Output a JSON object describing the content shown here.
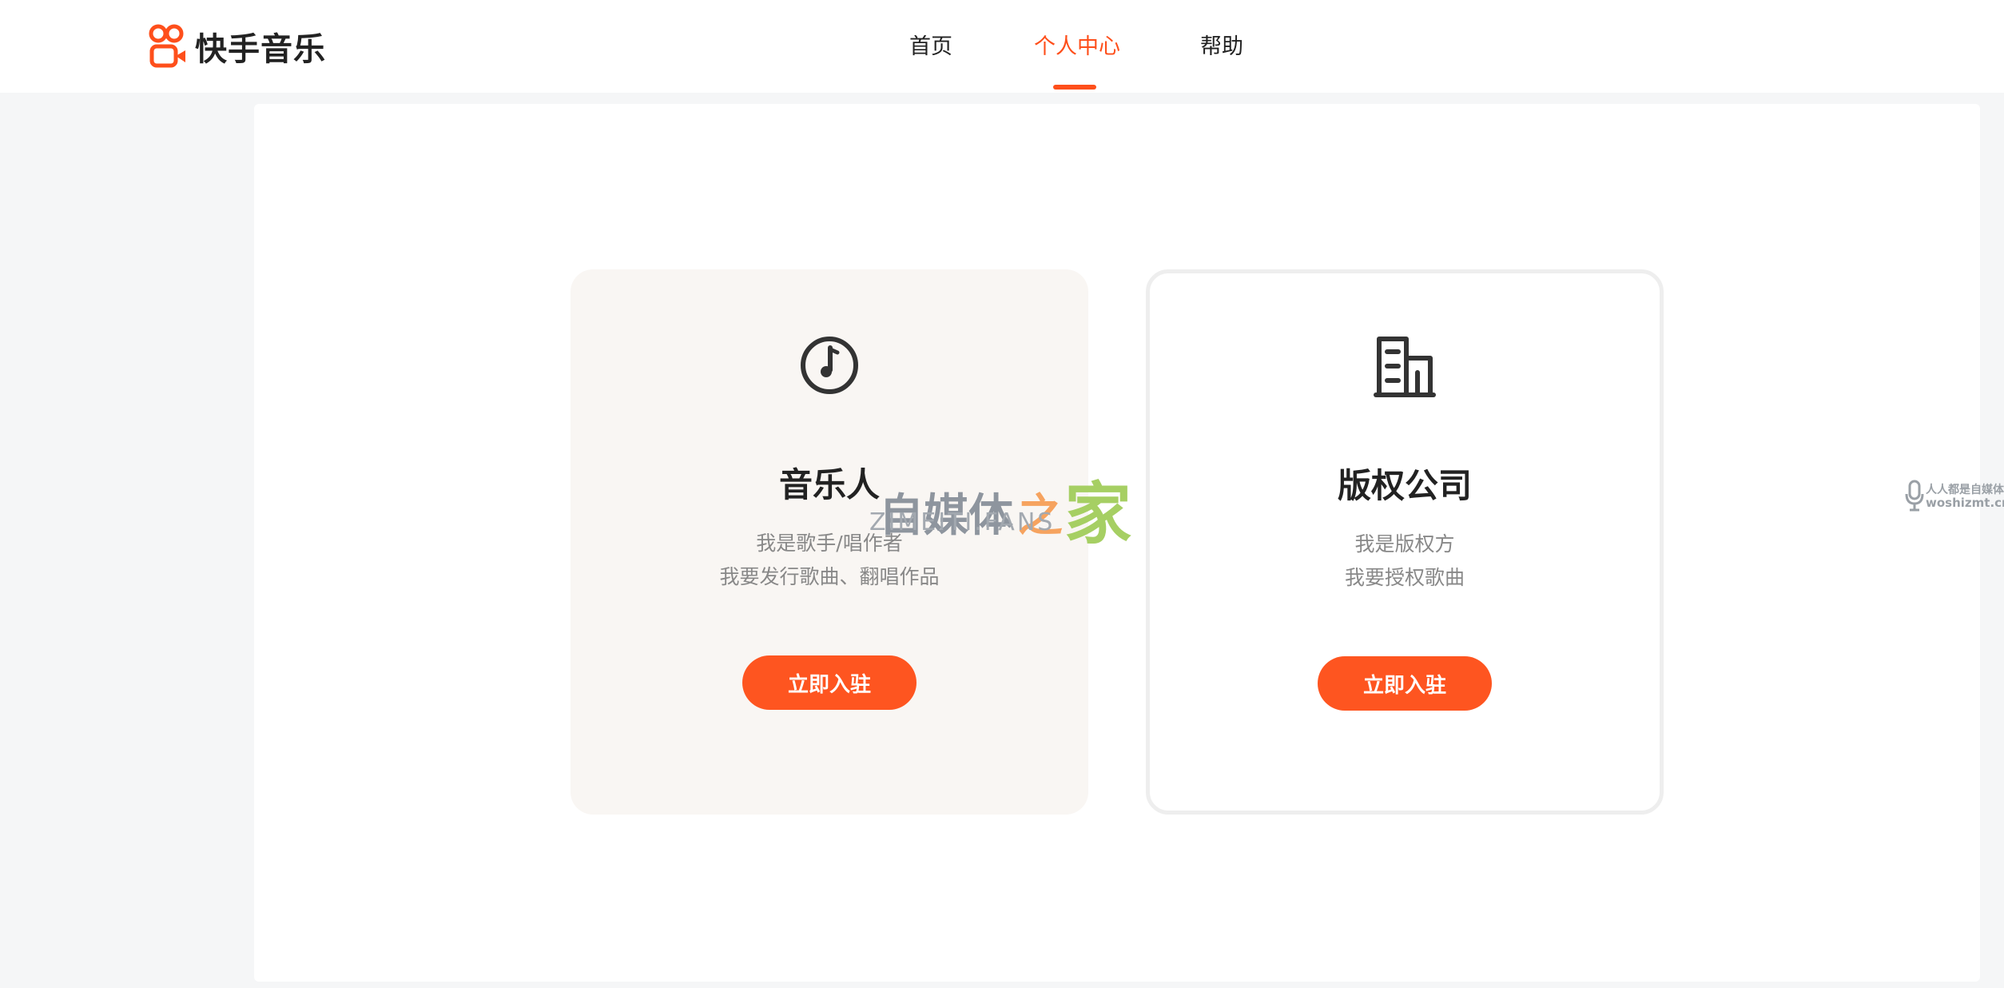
{
  "header": {
    "logo_text": "快手音乐",
    "nav": [
      {
        "label": "首页",
        "active": false
      },
      {
        "label": "个人中心",
        "active": true
      },
      {
        "label": "帮助",
        "active": false
      }
    ]
  },
  "cards": [
    {
      "icon": "music-disc-icon",
      "title": "音乐人",
      "desc_line1": "我是歌手/唱作者",
      "desc_line2": "我要发行歌曲、翻唱作品",
      "button": "立即入驻"
    },
    {
      "icon": "building-icon",
      "title": "版权公司",
      "desc_line1": "我是版权方",
      "desc_line2": "我要授权歌曲",
      "button": "立即入驻"
    }
  ],
  "watermark": {
    "chars_gray": "自媒体",
    "char_orange": "之",
    "char_green": "家",
    "subtitle": "ZIMEITI.FANS"
  },
  "watermark2": {
    "line1": "人人都是自媒体",
    "line2": "woshizmt.cn"
  },
  "colors": {
    "accent": "#fe4f1b",
    "button": "#fe5520",
    "page_bg": "#f5f6f7",
    "card_highlight_bg": "#f9f6f3"
  }
}
